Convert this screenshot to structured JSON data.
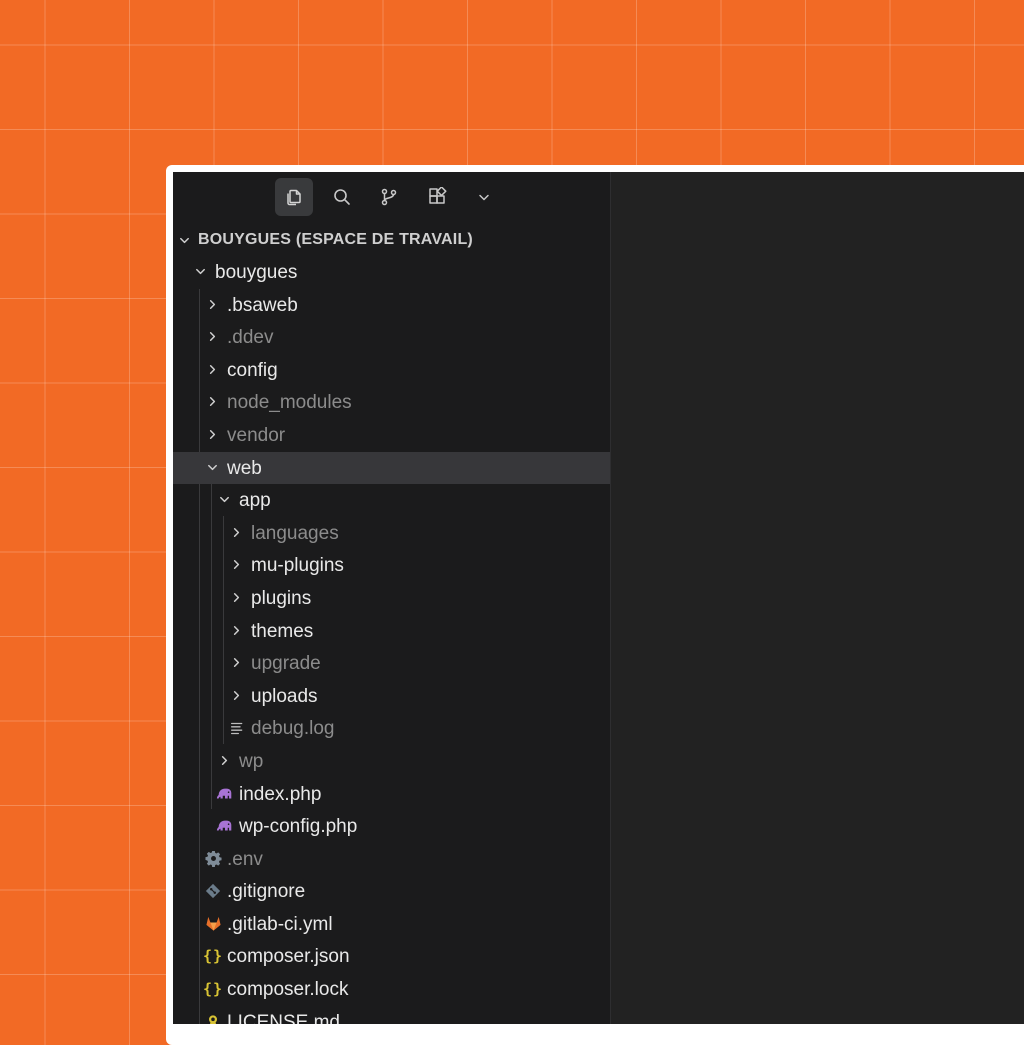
{
  "toolbar": {
    "buttons": [
      {
        "icon": "files-icon",
        "active": true
      },
      {
        "icon": "search-icon",
        "active": false
      },
      {
        "icon": "source-control-icon",
        "active": false
      },
      {
        "icon": "extensions-icon",
        "active": false
      },
      {
        "icon": "chevron-down-icon",
        "active": false
      }
    ]
  },
  "explorer": {
    "section_title": "BOUYGUES (ESPACE DE TRAVAIL)",
    "tree": [
      {
        "label": "bouygues",
        "depth": 0,
        "kind": "folder",
        "expanded": true,
        "dim": false
      },
      {
        "label": ".bsaweb",
        "depth": 1,
        "kind": "folder",
        "expanded": false,
        "dim": false
      },
      {
        "label": ".ddev",
        "depth": 1,
        "kind": "folder",
        "expanded": false,
        "dim": true
      },
      {
        "label": "config",
        "depth": 1,
        "kind": "folder",
        "expanded": false,
        "dim": false
      },
      {
        "label": "node_modules",
        "depth": 1,
        "kind": "folder",
        "expanded": false,
        "dim": true
      },
      {
        "label": "vendor",
        "depth": 1,
        "kind": "folder",
        "expanded": false,
        "dim": true
      },
      {
        "label": "web",
        "depth": 1,
        "kind": "folder",
        "expanded": true,
        "dim": false,
        "selected": true
      },
      {
        "label": "app",
        "depth": 2,
        "kind": "folder",
        "expanded": true,
        "dim": false
      },
      {
        "label": "languages",
        "depth": 3,
        "kind": "folder",
        "expanded": false,
        "dim": true
      },
      {
        "label": "mu-plugins",
        "depth": 3,
        "kind": "folder",
        "expanded": false,
        "dim": false
      },
      {
        "label": "plugins",
        "depth": 3,
        "kind": "folder",
        "expanded": false,
        "dim": false
      },
      {
        "label": "themes",
        "depth": 3,
        "kind": "folder",
        "expanded": false,
        "dim": false
      },
      {
        "label": "upgrade",
        "depth": 3,
        "kind": "folder",
        "expanded": false,
        "dim": true
      },
      {
        "label": "uploads",
        "depth": 3,
        "kind": "folder",
        "expanded": false,
        "dim": false
      },
      {
        "label": "debug.log",
        "depth": 3,
        "kind": "file",
        "icon": "log-file-icon",
        "dim": true
      },
      {
        "label": "wp",
        "depth": 2,
        "kind": "folder",
        "expanded": false,
        "dim": true
      },
      {
        "label": "index.php",
        "depth": 2,
        "kind": "file",
        "icon": "php-elephant-icon",
        "dim": false
      },
      {
        "label": "wp-config.php",
        "depth": 2,
        "kind": "file",
        "icon": "php-elephant-icon",
        "dim": false
      },
      {
        "label": ".env",
        "depth": 1,
        "kind": "file",
        "icon": "gear-icon",
        "dim": true
      },
      {
        "label": ".gitignore",
        "depth": 1,
        "kind": "file",
        "icon": "git-icon",
        "dim": false
      },
      {
        "label": ".gitlab-ci.yml",
        "depth": 1,
        "kind": "file",
        "icon": "gitlab-fox-icon",
        "dim": false
      },
      {
        "label": "composer.json",
        "depth": 1,
        "kind": "file",
        "icon": "braces-icon",
        "dim": false
      },
      {
        "label": "composer.lock",
        "depth": 1,
        "kind": "file",
        "icon": "braces-icon",
        "dim": false
      },
      {
        "label": "LICENSE.md",
        "depth": 1,
        "kind": "file",
        "icon": "license-icon",
        "dim": false
      }
    ]
  },
  "colors": {
    "background": "#f26a25",
    "sidebar": "#1b1b1c",
    "editor": "#222222",
    "selected_row": "#37373a",
    "php_icon": "#a873d4",
    "json_icon": "#d8c334",
    "gitlab_icon": "#e8702a"
  }
}
